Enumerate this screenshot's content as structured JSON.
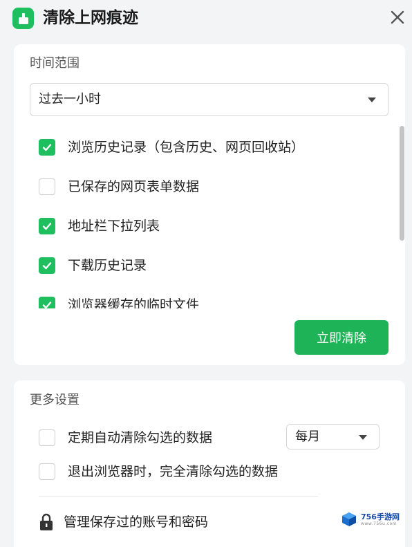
{
  "header": {
    "title": "清除上网痕迹",
    "app_icon": "broom-clean-icon",
    "close_icon": "close-icon"
  },
  "time_range": {
    "label": "时间范围",
    "selected": "过去一小时"
  },
  "options": [
    {
      "label": "浏览历史记录（包含历史、网页回收站）",
      "checked": true
    },
    {
      "label": "已保存的网页表单数据",
      "checked": false
    },
    {
      "label": "地址栏下拉列表",
      "checked": true
    },
    {
      "label": "下载历史记录",
      "checked": true
    },
    {
      "label": "浏览器缓存的临时文件",
      "checked": true
    }
  ],
  "clear_button": {
    "label": "立即清除"
  },
  "more_settings": {
    "label": "更多设置",
    "auto_clear": {
      "label": "定期自动清除勾选的数据",
      "checked": false,
      "frequency": "每月"
    },
    "clear_on_exit": {
      "label": "退出浏览器时，完全清除勾选的数据",
      "checked": false
    },
    "manage_passwords": {
      "label": "管理保存过的账号和密码",
      "icon": "lock-icon"
    }
  },
  "watermark": {
    "main": "756手游网",
    "sub": "www.756u.com"
  },
  "colors": {
    "accent": "#1fbf5f",
    "button": "#1db356",
    "background": "#f3f4f6"
  }
}
